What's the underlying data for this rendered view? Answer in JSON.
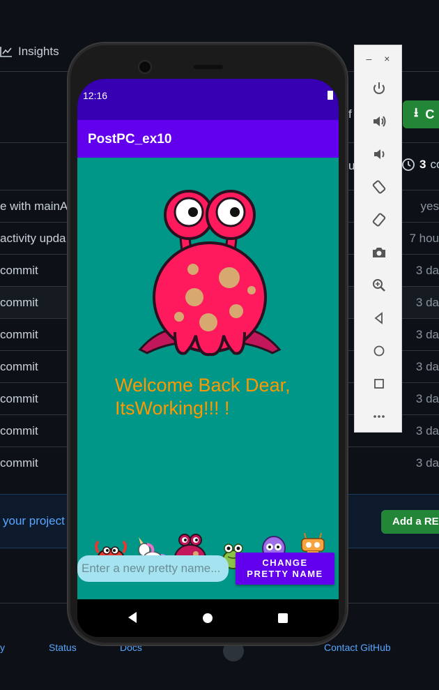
{
  "background": {
    "insights_label": "Insights",
    "code_button_label": "C",
    "commits_count": "3",
    "commits_suffix": "co",
    "commit_rows": [
      {
        "message": "e with mainAc",
        "age": "yes"
      },
      {
        "message": " activity upda",
        "age": "7 hou"
      },
      {
        "message": "commit",
        "age": "3 da"
      },
      {
        "message": "commit",
        "age": "3 da"
      },
      {
        "message": "commit",
        "age": "3 da"
      },
      {
        "message": "commit",
        "age": "3 da"
      },
      {
        "message": "commit",
        "age": "3 da"
      },
      {
        "message": "commit",
        "age": "3 da"
      },
      {
        "message": "commit",
        "age": "3 da"
      }
    ],
    "readme_prompt": "your project",
    "readme_button": "Add a REA",
    "footer": {
      "left": "y",
      "status": "Status",
      "docs": "Docs",
      "contact": "Contact GitHub"
    },
    "stub_f": "f",
    "stub_u": "u"
  },
  "emulator_toolbar": {
    "minimize": "–",
    "close": "×",
    "buttons": [
      "power-icon",
      "volume-up-icon",
      "volume-down-icon",
      "rotate-left-icon",
      "rotate-right-icon",
      "camera-icon",
      "zoom-icon",
      "back-icon",
      "home-icon",
      "overview-icon",
      "more-icon"
    ]
  },
  "phone": {
    "status_time": "12:16",
    "app_title": "PostPC_ex10",
    "welcome_text": "Welcome Back Dear, ItsWorking!!! !",
    "monsters": [
      "crab-icon",
      "unicorn-icon",
      "pink-monster-icon",
      "frog-icon",
      "octopus-icon",
      "robot-icon"
    ],
    "input_placeholder": "Enter a new pretty name...",
    "input_value": "",
    "change_button_line1": "CHANGE",
    "change_button_line2": "PRETTY NAME",
    "colors": {
      "status_bar": "#3700b3",
      "app_bar": "#6200ee",
      "content_bg": "#009688",
      "welcome": "#ff9800"
    }
  }
}
